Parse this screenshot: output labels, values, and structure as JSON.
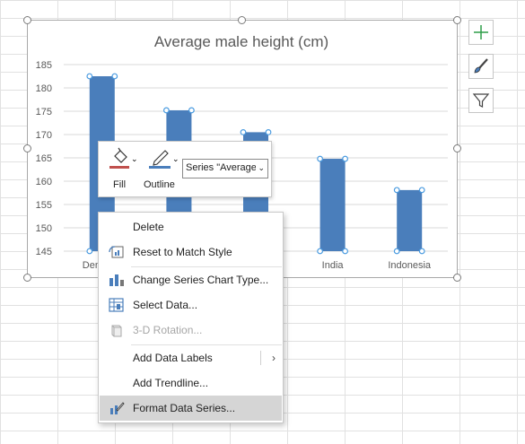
{
  "chart": {
    "title": "Average male height (cm)",
    "bar_color": "#4a7ebb",
    "handle_color": "#4a9be0"
  },
  "chart_data": {
    "type": "bar",
    "title": "Average male height (cm)",
    "categories": [
      "Denmark",
      "",
      "",
      "India",
      "Indonesia"
    ],
    "category_labels_visible": [
      "Denm",
      "",
      "",
      "India",
      "Indonesia"
    ],
    "values": [
      182.5,
      175.2,
      170.5,
      164.8,
      158.1
    ],
    "ylim": [
      145,
      185
    ],
    "yticks": [
      145,
      150,
      155,
      160,
      165,
      170,
      175,
      180,
      185
    ],
    "grid": true,
    "legend": "none"
  },
  "side_buttons": [
    {
      "name": "chart-elements-button",
      "icon": "plus-icon"
    },
    {
      "name": "chart-styles-button",
      "icon": "paintbrush-icon"
    },
    {
      "name": "chart-filters-button",
      "icon": "funnel-icon"
    }
  ],
  "mini_toolbar": {
    "fill_label": "Fill",
    "outline_label": "Outline",
    "series_value": "Series \"Average",
    "fill_color": "#c0504d",
    "outline_color": "#4a7ebb"
  },
  "context_menu": {
    "items": [
      {
        "label": "Delete",
        "icon": "none",
        "enabled": true
      },
      {
        "label": "Reset to Match Style",
        "icon": "reset-style-icon",
        "enabled": true
      },
      {
        "label": "Change Series Chart Type...",
        "icon": "chart-type-icon",
        "enabled": true
      },
      {
        "label": "Select Data...",
        "icon": "select-data-icon",
        "enabled": true
      },
      {
        "label": "3-D Rotation...",
        "icon": "3d-rotation-icon",
        "enabled": false
      },
      {
        "label": "Add Data Labels",
        "icon": "none",
        "enabled": true,
        "submenu": true
      },
      {
        "label": "Add Trendline...",
        "icon": "none",
        "enabled": true
      },
      {
        "label": "Format Data Series...",
        "icon": "format-series-icon",
        "enabled": true,
        "hovered": true
      }
    ]
  }
}
